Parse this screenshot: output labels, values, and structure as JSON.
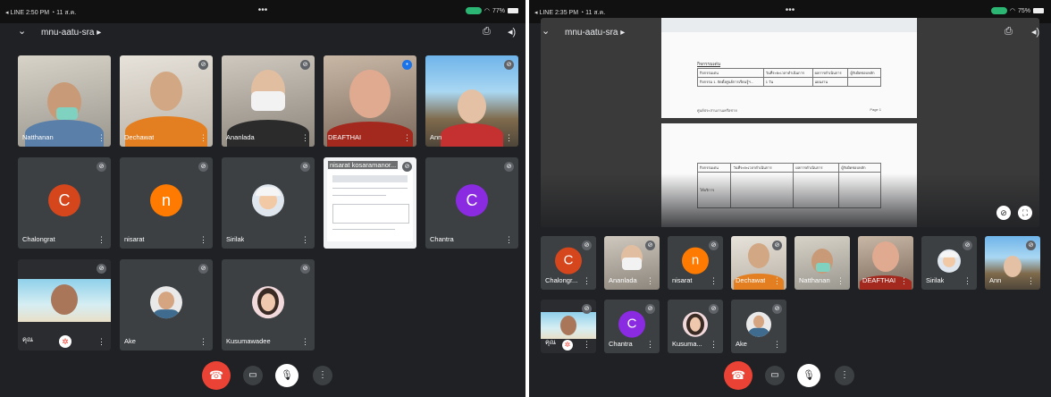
{
  "left": {
    "status": {
      "left": "◂ LINE  2:50 PM  ◔  11 ส.ค.",
      "center": "•••",
      "right": "77%"
    },
    "title": "mnu-aatu-sra",
    "tiles": [
      {
        "name": "Natthanan"
      },
      {
        "name": "Dechawat"
      },
      {
        "name": "Ananlada"
      },
      {
        "name": "DEAFTHAI"
      },
      {
        "name": "Ann"
      },
      {
        "name": "Chalongrat",
        "letter": "C"
      },
      {
        "name": "nisarat",
        "letter": "n"
      },
      {
        "name": "Sirilak"
      },
      {
        "name": "nisarat kosaramanor..."
      },
      {
        "name": "Chantra",
        "letter": "C"
      },
      {
        "name": "คุณ"
      },
      {
        "name": "Ake"
      },
      {
        "name": "Kusumawadee"
      }
    ]
  },
  "right": {
    "status": {
      "left": "◂ LINE  2:35 PM  ◔  11 ส.ค.",
      "center": "•••",
      "right": "75%"
    },
    "title": "mnu-aatu-sra",
    "doc_header": "กิจกรรมเด่น",
    "doc_cols": [
      "กิจกรรมเด่น",
      "วันที่ระยะเวลาดำเนินการ",
      "ผลการดำเนินการ",
      "ผู้รับผิดชอบหลัก"
    ],
    "doc_row1": [
      "กิจกรรม 1. จัดตั้งศูนย์การเรียนรู้ฯ...",
      "1 วัน",
      "แผนงาน",
      ""
    ],
    "doc_footer_left": "ศูนย์ประสานงานเครือข่าย",
    "doc_footer_right": "Page 1",
    "doc_row2": [
      "ให้บริการ",
      "",
      "",
      ""
    ],
    "strip": [
      {
        "name": "Chalongr...",
        "letter": "C"
      },
      {
        "name": "Ananlada"
      },
      {
        "name": "nisarat",
        "letter": "n"
      },
      {
        "name": "Dechawat"
      },
      {
        "name": "Natthanan"
      },
      {
        "name": "DEAFTHAI"
      },
      {
        "name": "Sirilak"
      },
      {
        "name": "Ann"
      },
      {
        "name": "คุณ"
      },
      {
        "name": "Chantra",
        "letter": "C"
      },
      {
        "name": "Kusuma..."
      },
      {
        "name": "Ake"
      }
    ]
  },
  "colors": {
    "bg": "#202124",
    "tile": "#3c4043",
    "end_call": "#ea4335",
    "c_orange": "#d5461d",
    "n_orange": "#ff7a00",
    "c_purple": "#8a2be2"
  }
}
